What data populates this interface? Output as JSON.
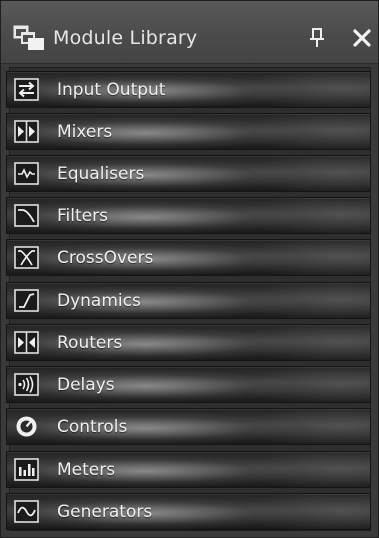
{
  "window": {
    "title": "Module Library",
    "title_icon": "stacked-windows-icon",
    "pin_icon": "pin-icon",
    "close_icon": "close-icon"
  },
  "categories": [
    {
      "label": "Input Output",
      "icon": "input-output-icon"
    },
    {
      "label": "Mixers",
      "icon": "mixer-icon"
    },
    {
      "label": "Equalisers",
      "icon": "equaliser-icon"
    },
    {
      "label": "Filters",
      "icon": "filter-icon"
    },
    {
      "label": "CrossOvers",
      "icon": "crossover-icon"
    },
    {
      "label": "Dynamics",
      "icon": "dynamics-icon"
    },
    {
      "label": "Routers",
      "icon": "router-icon"
    },
    {
      "label": "Delays",
      "icon": "delay-icon"
    },
    {
      "label": "Controls",
      "icon": "control-icon"
    },
    {
      "label": "Meters",
      "icon": "meter-icon"
    },
    {
      "label": "Generators",
      "icon": "generator-icon"
    }
  ]
}
